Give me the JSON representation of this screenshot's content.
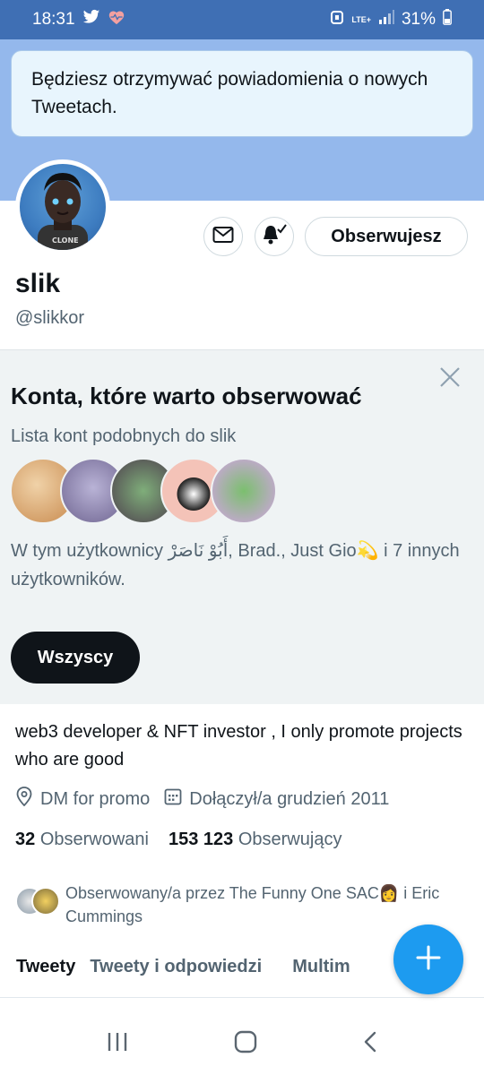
{
  "status_bar": {
    "time": "18:31",
    "net_label": "LTE+",
    "battery": "31%"
  },
  "toast": {
    "message": "Będziesz otrzymywać powiadomienia o nowych Tweetach."
  },
  "profile": {
    "name": "slik",
    "handle": "@slikkor",
    "follow_button": "Obserwujesz",
    "bio": "web3 developer & NFT investor , I only promote projects who are good",
    "location": "DM for promo",
    "joined": "Dołączył/a grudzień 2011",
    "following_count": "32",
    "following_label": "Obserwowani",
    "followers_count": "153 123",
    "followers_label": "Obserwujący",
    "followed_by": "Obserwowany/a przez The Funny One SAC👩 i Eric Cummings"
  },
  "suggestions": {
    "title": "Konta, które warto obserwować",
    "subtitle": "Lista kont podobnych do slik",
    "includes_text": "W tym użytkownicy أَبُوْ نَاصَرْ, Brad., Just Gio💫 i 7 innych użytkowników.",
    "all_button": "Wszyscy",
    "face_colors": [
      "#d9a66e",
      "#8a7fa8",
      "#6b5d6e",
      "#f1b8b0",
      "#c99ad6"
    ]
  },
  "tabs": [
    {
      "label": "Tweety",
      "active": true
    },
    {
      "label": "Tweety i odpowiedzi",
      "active": false
    },
    {
      "label": "Multim",
      "active": false
    }
  ],
  "colors": {
    "accent": "#1d9bf0",
    "banner": "#94b8ec",
    "status_bar": "#3f6fb4"
  },
  "icons": {
    "status": [
      "twitter-bird-icon",
      "heart-pulse-icon",
      "alarm-icon",
      "signal-icon",
      "battery-icon"
    ],
    "nav": [
      "recents-icon",
      "home-icon",
      "back-icon"
    ]
  }
}
